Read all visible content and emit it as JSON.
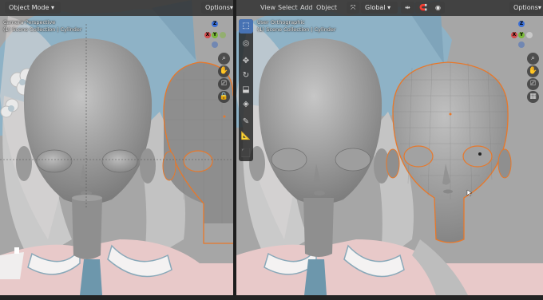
{
  "app": "Blender",
  "left_viewport": {
    "mode_dropdown": "Object Mode",
    "options_label": "Options",
    "view_name": "Camera Perspective",
    "collection_info": "(1) Scene Collection | Cylinder"
  },
  "right_viewport": {
    "menus": [
      "View",
      "Select",
      "Add",
      "Object"
    ],
    "transform_label": "Global",
    "options_label": "Options",
    "view_name": "User Orthographic",
    "collection_info": "(1) Scene Collection | Cylinder"
  },
  "gizmo_labels": {
    "x": "X",
    "y": "Y",
    "z": "Z"
  },
  "tools": [
    {
      "icon": "select-box-icon",
      "glyph": "⬚",
      "active": true
    },
    {
      "icon": "cursor-icon",
      "glyph": "◎",
      "active": false
    },
    {
      "icon": "move-icon",
      "glyph": "✥",
      "active": false
    },
    {
      "icon": "rotate-icon",
      "glyph": "↻",
      "active": false
    },
    {
      "icon": "scale-icon",
      "glyph": "⬓",
      "active": false
    },
    {
      "icon": "transform-icon",
      "glyph": "◈",
      "active": false
    },
    {
      "icon": "annotate-icon",
      "glyph": "✎",
      "active": false
    },
    {
      "icon": "measure-icon",
      "glyph": "📐",
      "active": false
    },
    {
      "icon": "add-cube-icon",
      "glyph": "⬛",
      "active": false
    }
  ],
  "nav_buttons": [
    {
      "icon": "zoom-icon",
      "glyph": "⌕"
    },
    {
      "icon": "hand-pan-icon",
      "glyph": "✋"
    },
    {
      "icon": "camera-view-icon",
      "glyph": "⎚"
    },
    {
      "icon": "perspective-grid-icon",
      "glyph": "▦"
    }
  ],
  "colors": {
    "selection_outline": "#e8782a",
    "bow_blue": "#7fa9c0",
    "clay": "#a9a9a9",
    "header_bg": "#303030"
  }
}
